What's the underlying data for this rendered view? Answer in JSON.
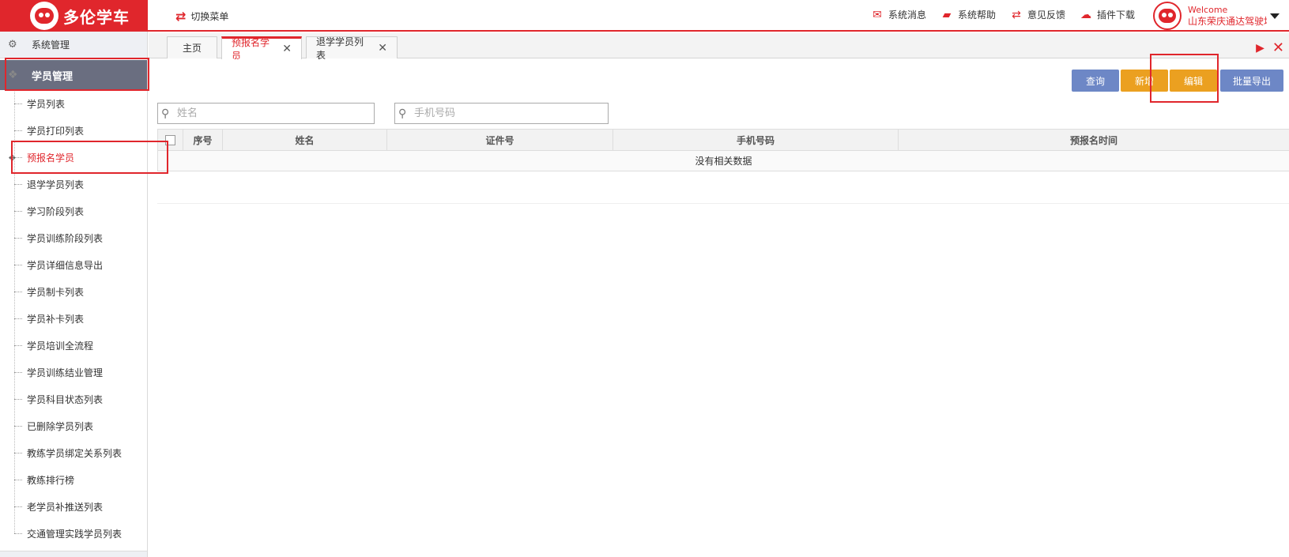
{
  "brand": {
    "name": "多伦学车"
  },
  "header": {
    "switch_menu": "切换菜单",
    "links": [
      {
        "icon": "envelope-icon",
        "label": "系统消息"
      },
      {
        "icon": "book-icon",
        "label": "系统帮助"
      },
      {
        "icon": "exchange-icon",
        "label": "意见反馈"
      },
      {
        "icon": "cloud-download-icon",
        "label": "插件下载"
      }
    ],
    "user": {
      "welcome": "Welcome",
      "name": "山东荣庆通达驾驶培训"
    }
  },
  "sidebar": {
    "top_item": "系统管理",
    "group": "学员管理",
    "items": [
      "学员列表",
      "学员打印列表",
      "预报名学员",
      "退学学员列表",
      "学习阶段列表",
      "学员训练阶段列表",
      "学员详细信息导出",
      "学员制卡列表",
      "学员补卡列表",
      "学员培训全流程",
      "学员训练结业管理",
      "学员科目状态列表",
      "已删除学员列表",
      "教练学员绑定关系列表",
      "教练排行榜",
      "老学员补推送列表",
      "交通管理实践学员列表"
    ],
    "active_index": 2
  },
  "tabs": [
    {
      "label": "主页",
      "closable": false
    },
    {
      "label": "预报名学员",
      "closable": true,
      "active": true
    },
    {
      "label": "退学学员列表",
      "closable": true
    }
  ],
  "toolbar": {
    "query": "查询",
    "add": "新增",
    "edit": "编辑",
    "export": "批量导出"
  },
  "search": {
    "name_placeholder": "姓名",
    "phone_placeholder": "手机号码"
  },
  "table": {
    "columns": [
      "序号",
      "姓名",
      "证件号",
      "手机号码",
      "预报名时间"
    ],
    "empty_text": "没有相关数据"
  },
  "colors": {
    "brand_red": "#e0262c",
    "button_blue": "#6d87c6",
    "button_orange": "#eba020",
    "sidebar_group": "#6a6e80"
  }
}
